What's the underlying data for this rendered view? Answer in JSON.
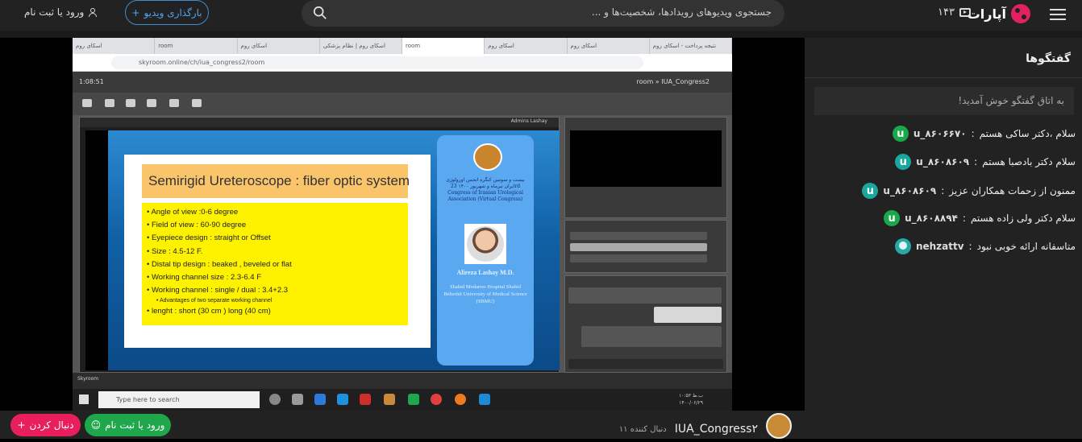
{
  "header": {
    "logo_text": "آپارات",
    "live_count": "۱۴۳",
    "search_placeholder": "جستجوی ویدیوهای رویدادها، شخصیت‌ها و ...",
    "upload_label": "بارگذاری ویدیو",
    "login_label": "ورود یا ثبت نام",
    "accent_color": "#e2215f"
  },
  "video": {
    "browser_tabs": [
      "اسکای روم",
      "room",
      "اسکای روم",
      "اسکای روم | نظام پزشکی",
      "room",
      "اسکای روم",
      "اسکای روم",
      "نتیجه پرداخت - اسکای روم"
    ],
    "url": "skyroom.online/ch/iua_congress2/room",
    "session_time": "1:08:51",
    "room_name": "room » IUA_Congress2",
    "panel_label": "Admins Lashay",
    "skyroom_label": "Skyroom",
    "taskbar_search": "Type here to search",
    "taskbar_time": "۱۰:۵۳ ب.ظ",
    "taskbar_date": "۱۴۰۰/۰۶/۲۹",
    "slide": {
      "title": "Semirigid Ureteroscope : fiber optic system",
      "bullets": [
        "Angle of view :0-6 degree",
        "Field of view : 60-90 degree",
        "Eyepiece design : straight or Offset",
        "Size : 4.5-12 F.",
        "Distal tip design : beaked , beveled or flat",
        "Working channel size : 2.3-6.4 F",
        "Working channel : single / dual : 3.4+2.3"
      ],
      "sub_bullet": "Advantages of two separate working channel",
      "last_bullet": "lenght : short (30 cm ) long (40 cm)",
      "card_text": "بیست و سومین کنگره انجمن اورولوژی ایران تیرماه و شهریور ۱۴۰۰ 23rd Congress of Iranian Urological Association (Virtual Congress)",
      "card_name": "Alireza Lashay M.D.",
      "card_affiliation": "Shahid Modarres Hospital Shahid Beheshti University of Medical Science (SBMU)"
    }
  },
  "chat": {
    "title": "گفتگوها",
    "welcome": "به اتاق گفتگو خوش آمدید!",
    "messages": [
      {
        "user": "u_۸۶۰۶۶۷۰",
        "text": "سلام ،دکتر ساکی هستم",
        "avatar": "u",
        "color": "#19a84a"
      },
      {
        "user": "u_۸۶۰۸۶۰۹",
        "text": "سلام دکتر بادصبا هستم",
        "avatar": "u",
        "color": "#19a8a0"
      },
      {
        "user": "u_۸۶۰۸۶۰۹",
        "text": "ممنون از زحمات همکاران عزیز",
        "avatar": "u",
        "color": "#19a8a0"
      },
      {
        "user": "u_۸۶۰۸۸۹۴",
        "text": "سلام دکتر ولی زاده هستم",
        "avatar": "u",
        "color": "#19a84a"
      },
      {
        "user": "nehzattv",
        "text": "متاسفانه ارائه خوبی نبود",
        "avatar": "img",
        "color": "#2aa8a8"
      }
    ]
  },
  "footer": {
    "follow_label": "دنبال کردن",
    "login_label": "ورود یا ثبت نام",
    "channel_name": "IUA_Congress۲",
    "followers": "۱۱ دنبال کننده",
    "follow_color": "#e91e5d",
    "login_color": "#1fa84b"
  }
}
